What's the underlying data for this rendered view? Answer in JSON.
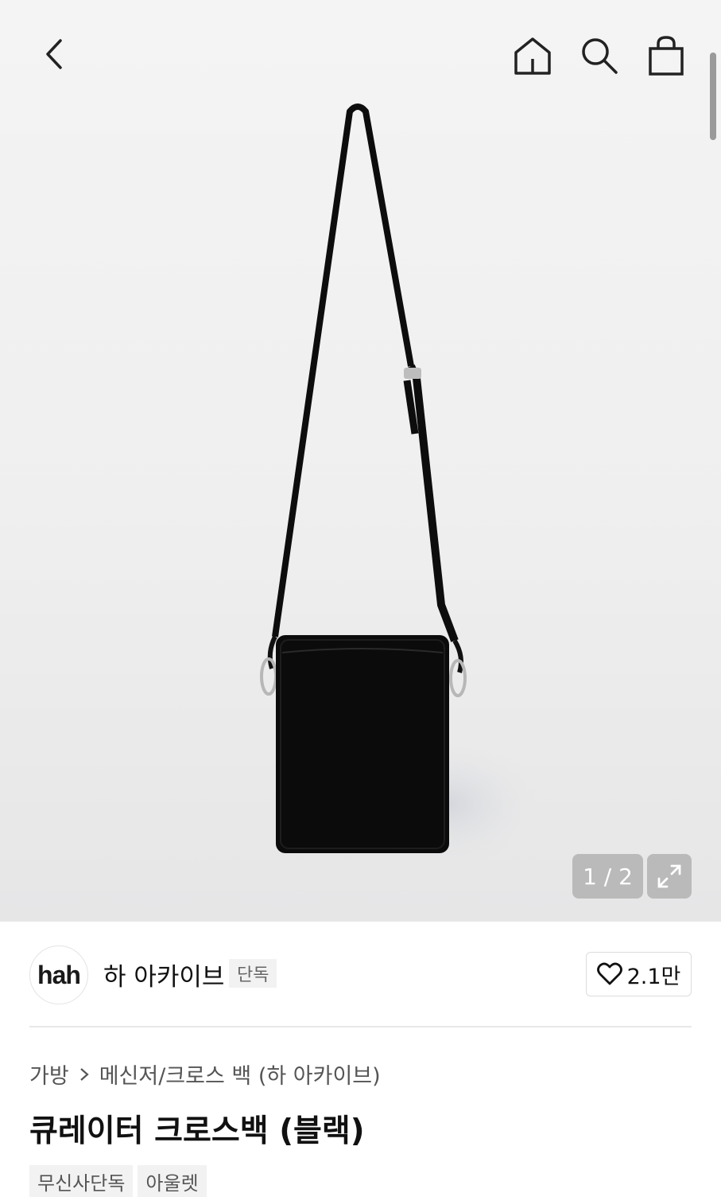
{
  "header": {
    "back_icon": "chevron-left-icon",
    "home_icon": "home-icon",
    "search_icon": "search-icon",
    "cart_icon": "shopping-bag-icon"
  },
  "gallery": {
    "counter": "1 / 2",
    "expand_icon": "expand-icon",
    "current_index": 1,
    "total": 2
  },
  "brand": {
    "logo_text": "hah",
    "name": "하 아카이브",
    "tag": "단독",
    "like_count": "2.1만",
    "like_icon": "heart-icon"
  },
  "breadcrumb": {
    "category": "가방",
    "subcategory": "메신저/크로스 백 (하 아카이브)"
  },
  "product": {
    "title": "큐레이터 크로스백 (블랙)",
    "badges": [
      "무신사단독",
      "아울렛"
    ]
  },
  "colors": {
    "hero_bg": "#f0f0f0",
    "counter_bg": "#9c9c9c",
    "tag_bg": "#f2f2f2",
    "text_primary": "#111111",
    "text_secondary": "#555555"
  }
}
